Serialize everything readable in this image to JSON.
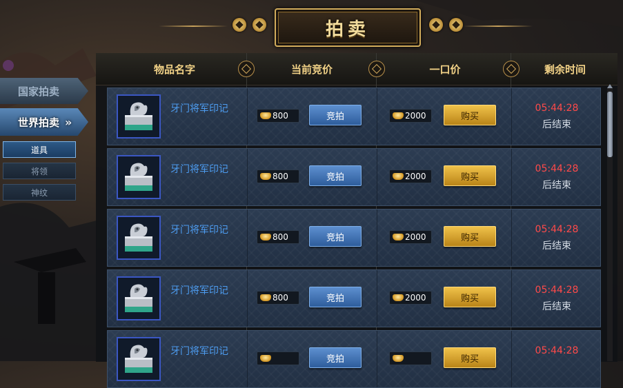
{
  "title": "拍卖",
  "nav": {
    "tabs": [
      {
        "label": "国家拍卖",
        "active": false
      },
      {
        "label": "世界拍卖",
        "active": true
      }
    ],
    "sub_items": [
      {
        "label": "道具",
        "active": true
      },
      {
        "label": "将领",
        "active": false
      },
      {
        "label": "神纹",
        "active": false
      }
    ]
  },
  "table": {
    "headers": [
      "物品名字",
      "当前竞价",
      "一口价",
      "剩余时间"
    ],
    "bid_label": "竞拍",
    "buy_label": "购买",
    "rows": [
      {
        "name": "牙门将军印记",
        "current_bid": "800",
        "buyout": "2000",
        "time": "05:44:28",
        "time_suffix": "后结束"
      },
      {
        "name": "牙门将军印记",
        "current_bid": "800",
        "buyout": "2000",
        "time": "05:44:28",
        "time_suffix": "后结束"
      },
      {
        "name": "牙门将军印记",
        "current_bid": "800",
        "buyout": "2000",
        "time": "05:44:28",
        "time_suffix": "后结束"
      },
      {
        "name": "牙门将军印记",
        "current_bid": "800",
        "buyout": "2000",
        "time": "05:44:28",
        "time_suffix": "后结束"
      },
      {
        "name": "牙门将军印记",
        "current_bid": "",
        "buyout": "",
        "time": "05:44:28",
        "time_suffix": ""
      }
    ]
  },
  "icons": {
    "sort": "sort-icon",
    "item": "seal-icon",
    "currency": "gold-ingot-icon",
    "tab_arrow": "chevron-right-icon"
  },
  "colors": {
    "title_gold": "#f3dc9c",
    "header_gold": "#f2d287",
    "item_name_blue": "#4d9cf0",
    "timer_red": "#ff4a4a",
    "bid_button_blue": "#2e5d9c",
    "buy_button_gold": "#d9a530"
  }
}
